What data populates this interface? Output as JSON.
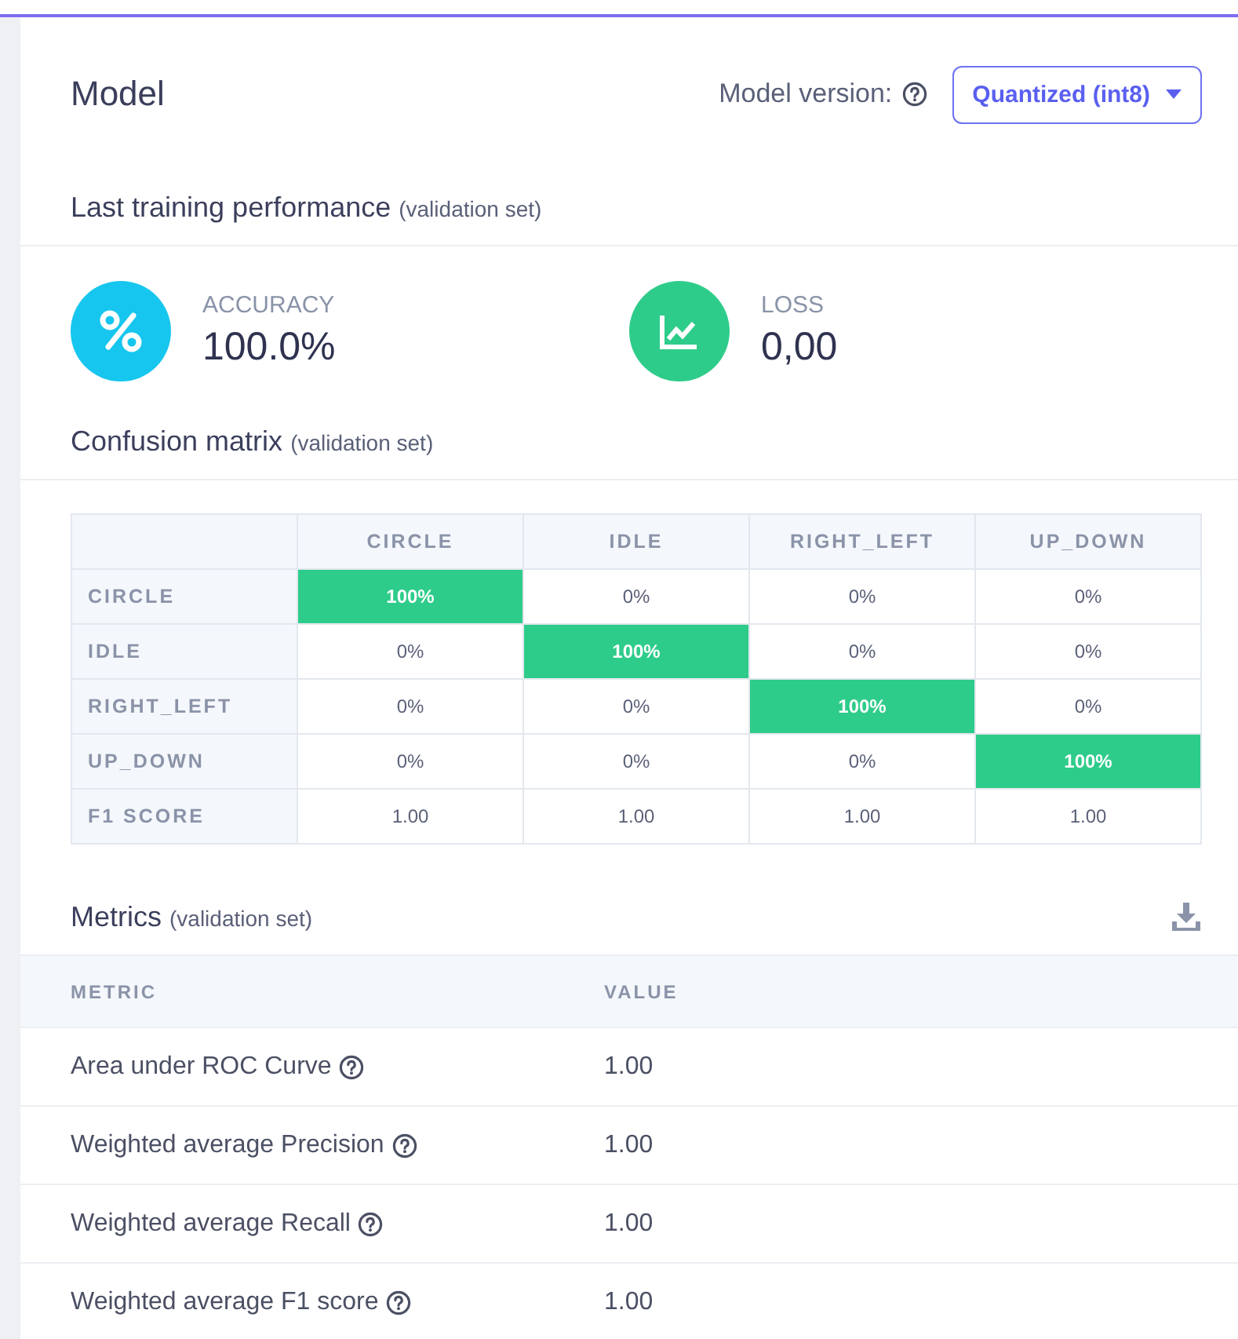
{
  "header": {
    "title": "Model",
    "version_label": "Model version:",
    "version_value": "Quantized (int8)"
  },
  "performance": {
    "title": "Last training performance",
    "note": "(validation set)",
    "stats": [
      {
        "kind": "percent",
        "label": "ACCURACY",
        "value": "100.0%"
      },
      {
        "kind": "chart",
        "label": "LOSS",
        "value": "0,00"
      }
    ]
  },
  "confusion": {
    "title": "Confusion matrix",
    "note": "(validation set)",
    "columns": [
      "CIRCLE",
      "IDLE",
      "RIGHT_LEFT",
      "UP_DOWN"
    ],
    "rows": [
      {
        "label": "CIRCLE",
        "cells": [
          {
            "text": "100%",
            "highlighted": true
          },
          {
            "text": "0%",
            "highlighted": false
          },
          {
            "text": "0%",
            "highlighted": false
          },
          {
            "text": "0%",
            "highlighted": false
          }
        ]
      },
      {
        "label": "IDLE",
        "cells": [
          {
            "text": "0%",
            "highlighted": false
          },
          {
            "text": "100%",
            "highlighted": true
          },
          {
            "text": "0%",
            "highlighted": false
          },
          {
            "text": "0%",
            "highlighted": false
          }
        ]
      },
      {
        "label": "RIGHT_LEFT",
        "cells": [
          {
            "text": "0%",
            "highlighted": false
          },
          {
            "text": "0%",
            "highlighted": false
          },
          {
            "text": "100%",
            "highlighted": true
          },
          {
            "text": "0%",
            "highlighted": false
          }
        ]
      },
      {
        "label": "UP_DOWN",
        "cells": [
          {
            "text": "0%",
            "highlighted": false
          },
          {
            "text": "0%",
            "highlighted": false
          },
          {
            "text": "0%",
            "highlighted": false
          },
          {
            "text": "100%",
            "highlighted": true
          }
        ]
      },
      {
        "label": "F1 SCORE",
        "cells": [
          {
            "text": "1.00",
            "highlighted": false
          },
          {
            "text": "1.00",
            "highlighted": false
          },
          {
            "text": "1.00",
            "highlighted": false
          },
          {
            "text": "1.00",
            "highlighted": false
          }
        ]
      }
    ]
  },
  "metrics": {
    "title": "Metrics",
    "note": "(validation set)",
    "columns": [
      "METRIC",
      "VALUE"
    ],
    "rows": [
      {
        "metric": "Area under ROC Curve",
        "value": "1.00"
      },
      {
        "metric": "Weighted average Precision",
        "value": "1.00"
      },
      {
        "metric": "Weighted average Recall",
        "value": "1.00"
      },
      {
        "metric": "Weighted average F1 score",
        "value": "1.00"
      }
    ]
  }
}
